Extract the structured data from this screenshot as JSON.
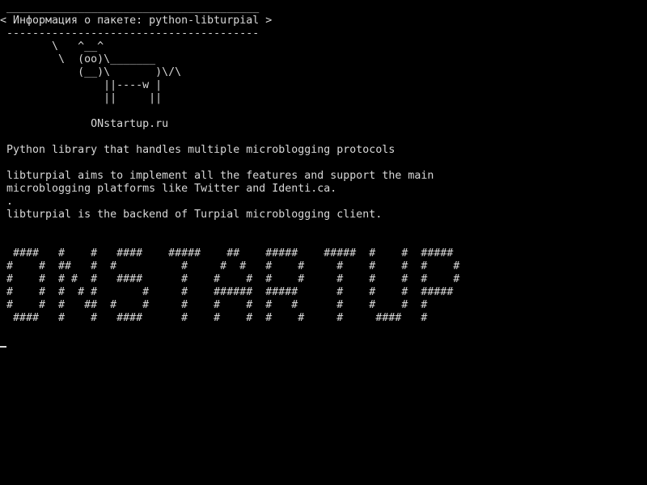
{
  "terminal": {
    "lines": [
      " _______________________________________",
      "< Информация о пакете: python-libturpial >",
      " ---------------------------------------",
      "        \\   ^__^",
      "         \\  (oo)\\_______",
      "            (__)\\       )\\/\\",
      "                ||----w |",
      "                ||     ||",
      "",
      "              ONstartup.ru",
      "",
      " Python library that handles multiple microblogging protocols",
      "",
      " libturpial aims to implement all the features and support the main",
      " microblogging platforms like Twitter and Identi.ca.",
      " .",
      " libturpial is the backend of Turpial microblogging client.",
      "",
      "",
      "  ####   #    #   ####    #####    ##    #####    #####  #    #  #####",
      " #    #  ##   #  #          #     #  #   #    #     #    #    #  #    #",
      " #    #  # #  #   ####      #    #    #  #    #     #    #    #  #    #",
      " #    #  #  # #       #     #    ######  #####      #    #    #  #####",
      " #    #  #   ##  #    #     #    #    #  #   #      #    #    #  #",
      "  ####   #    #   ####      #    #    #  #    #     #     ####   #"
    ]
  },
  "colors": {
    "background": "#000000",
    "text": "#d8d8d8"
  }
}
